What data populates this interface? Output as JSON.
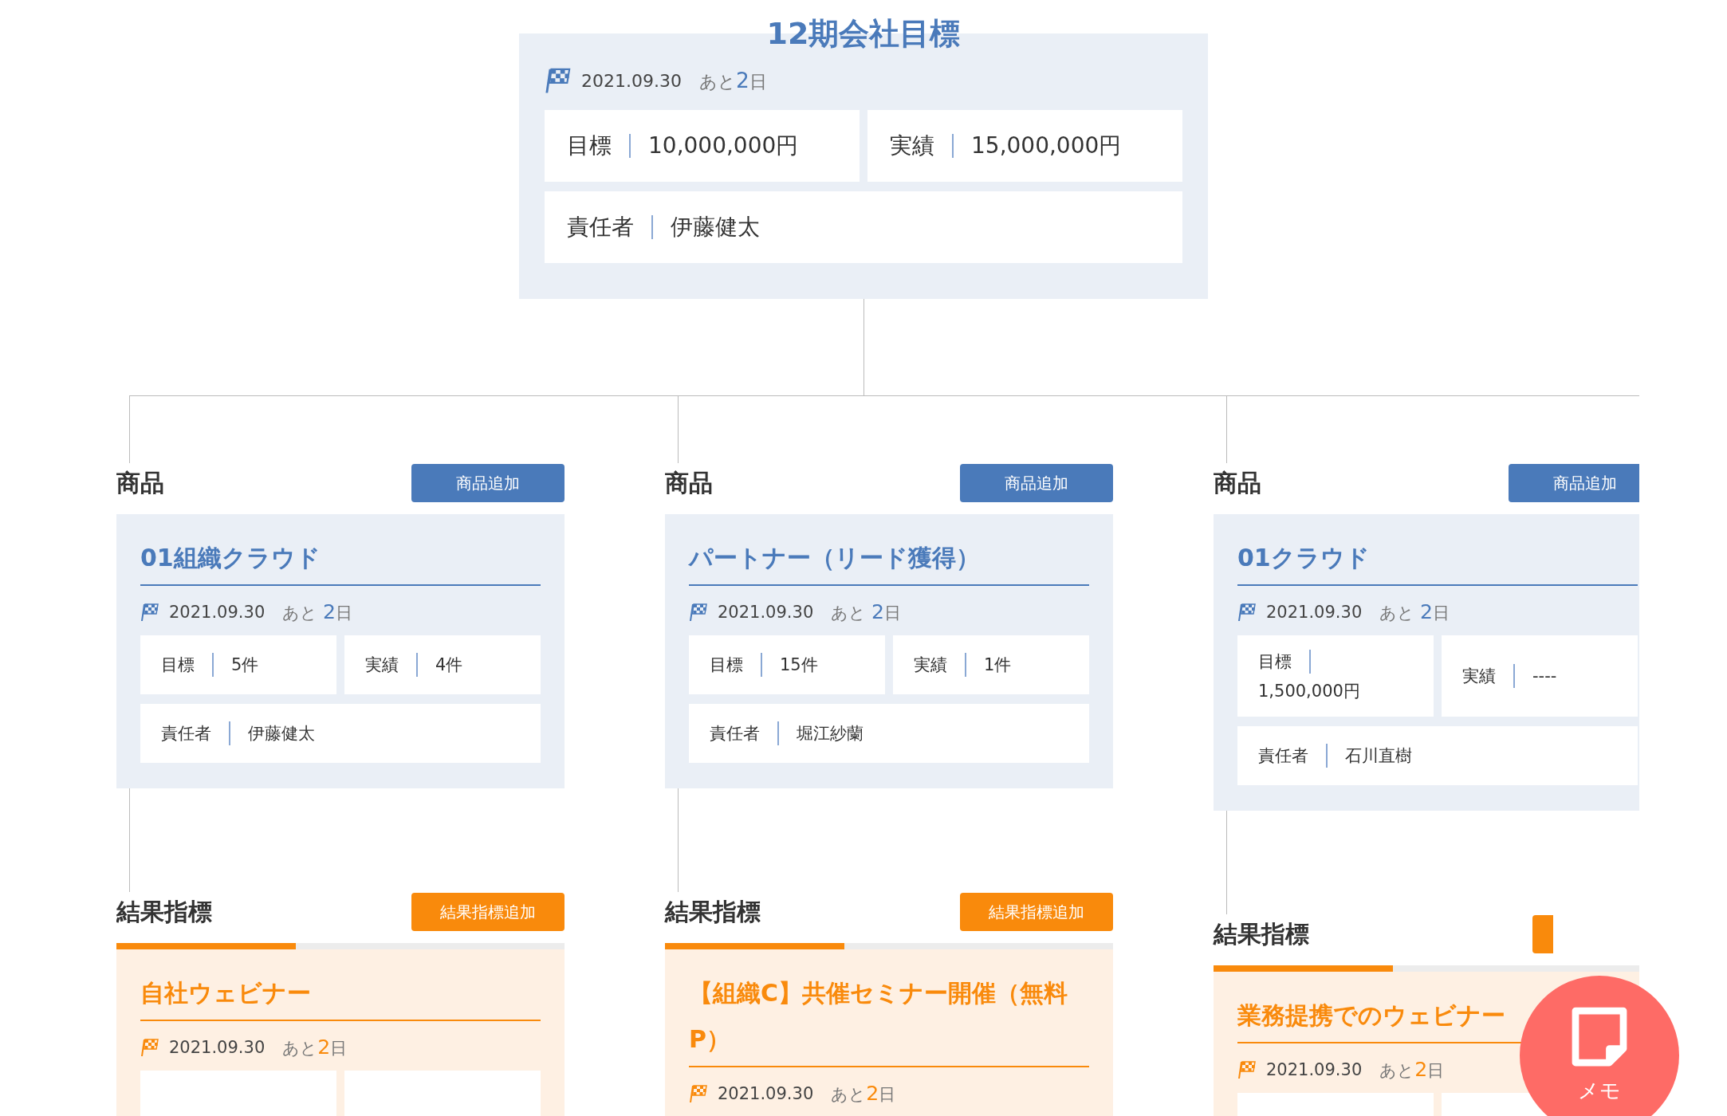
{
  "goal": {
    "title": "12期会社目標",
    "date": "2021.09.30",
    "remaining_prefix": "あと",
    "remaining_days": "2",
    "remaining_suffix": "日",
    "metrics": [
      {
        "label": "目標",
        "value": "10,000,000円"
      },
      {
        "label": "実績",
        "value": "15,000,000円"
      }
    ],
    "owner": {
      "label": "責任者",
      "value": "伊藤健太"
    }
  },
  "branches": [
    {
      "product": {
        "heading": "商品",
        "add_button": "商品追加",
        "title": "01組織クラウド",
        "date": "2021.09.30",
        "remaining_prefix": "あと",
        "remaining_days": "2",
        "remaining_suffix": "日",
        "metrics": [
          {
            "label": "目標",
            "value": "5件"
          },
          {
            "label": "実績",
            "value": "4件"
          }
        ],
        "owner": {
          "label": "責任者",
          "value": "伊藤健太"
        }
      },
      "result": {
        "heading": "結果指標",
        "add_button": "結果指標追加",
        "level": 0.4,
        "title": "自社ウェビナー",
        "date": "2021.09.30",
        "remaining_prefix": "あと",
        "remaining_days": "2",
        "remaining_suffix": "日"
      }
    },
    {
      "product": {
        "heading": "商品",
        "add_button": "商品追加",
        "title": "パートナー（リード獲得）",
        "date": "2021.09.30",
        "remaining_prefix": "あと",
        "remaining_days": "2",
        "remaining_suffix": "日",
        "metrics": [
          {
            "label": "目標",
            "value": "15件"
          },
          {
            "label": "実績",
            "value": "1件"
          }
        ],
        "owner": {
          "label": "責任者",
          "value": "堀江紗蘭"
        }
      },
      "result": {
        "heading": "結果指標",
        "add_button": "結果指標追加",
        "level": 0.4,
        "title": "【組織C】共催セミナー開催（無料P）",
        "date": "2021.09.30",
        "remaining_prefix": "あと",
        "remaining_days": "2",
        "remaining_suffix": "日"
      }
    },
    {
      "product": {
        "heading": "商品",
        "add_button": "商品追加",
        "title": "01クラウド",
        "date": "2021.09.30",
        "remaining_prefix": "あと",
        "remaining_days": "2",
        "remaining_suffix": "日",
        "metrics": [
          {
            "label": "目標",
            "value": "1,500,000円"
          },
          {
            "label": "実績",
            "value": "----"
          }
        ],
        "owner": {
          "label": "責任者",
          "value": "石川直樹"
        }
      },
      "result": {
        "heading": "結果指標",
        "level": 0.4,
        "title": "業務提携でのウェビナー",
        "date": "2021.09.30",
        "remaining_prefix": "あと",
        "remaining_days": "2",
        "remaining_suffix": "日"
      }
    }
  ],
  "memo_button": {
    "label": "メモ"
  }
}
